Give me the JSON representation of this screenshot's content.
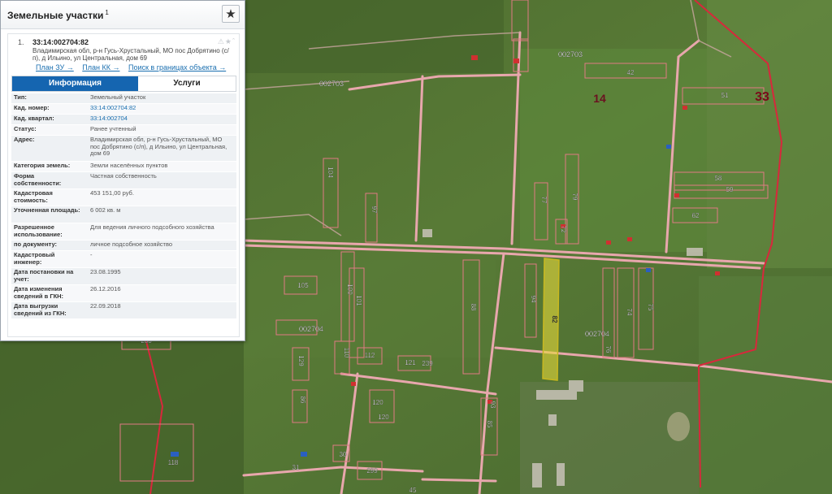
{
  "panel": {
    "title": "Земельные участки",
    "title_count": "1",
    "fav_icon": "★"
  },
  "result": {
    "number": "1.",
    "cad_number": "33:14:002704:82",
    "address": "Владимирская обл, р-н Гусь-Хрустальный, МО пос Добрятино (с/п), д Ильино, ул Центральная, дом 69",
    "links": [
      "План ЗУ →",
      "План КК →",
      "Поиск в границах объекта →"
    ],
    "tabs": {
      "info": "Информация",
      "services": "Услуги"
    },
    "rows": [
      {
        "label": "Тип:",
        "value": "Земельный участок"
      },
      {
        "label": "Кад. номер:",
        "value": "33:14:002704:82"
      },
      {
        "label": "Кад. квартал:",
        "value": "33:14:002704"
      },
      {
        "label": "Статус:",
        "value": "Ранее учтенный"
      },
      {
        "label": "Адрес:",
        "value": "Владимирская обл, р-н Гусь-Хрустальный, МО пос Добрятино (с/п), д Ильино, ул Центральная, дом 69"
      },
      {
        "label": "Категория земель:",
        "value": "Земли населённых пунктов"
      },
      {
        "label": "Форма собственности:",
        "value": "Частная собственность"
      },
      {
        "label": "Кадастровая стоимость:",
        "value": "453 151,00 руб."
      },
      {
        "label": "Уточненная площадь:",
        "value": "6 002 кв. м"
      },
      {
        "label": "Разрешенное использование:",
        "value": "Для ведения личного подсобного хозяйства"
      },
      {
        "label": "по документу:",
        "value": "личное подсобное хозяйство"
      },
      {
        "label": "Кадастровый инженер:",
        "value": "-"
      },
      {
        "label": "Дата постановки на учет:",
        "value": "23.08.1995"
      },
      {
        "label": "Дата изменения сведений в ГКН:",
        "value": "26.12.2016"
      },
      {
        "label": "Дата выгрузки сведений из ГКН:",
        "value": "22.09.2018"
      }
    ]
  },
  "map": {
    "colors": {
      "boundary": "#e8a0a8",
      "selected": "#e6d93a",
      "district_line": "#d8283c"
    },
    "labels": {
      "q1": "002703",
      "q2": "002703",
      "q3": "002704",
      "q4": "002704",
      "district14": "14",
      "district33": "33",
      "p42": "42",
      "p51": "51",
      "p58": "58",
      "p59": "59",
      "p62": "62",
      "p104": "104",
      "p97": "97",
      "p77": "77",
      "p79": "79",
      "p72": "72",
      "p105": "105",
      "p100": "100",
      "p101": "101",
      "p88": "88",
      "p94": "94",
      "p82": "82",
      "p74": "74",
      "p75": "75",
      "p76": "76",
      "p112": "112",
      "p121": "121",
      "p239": "239",
      "p120a": "120",
      "p120b": "120",
      "p118": "118",
      "p30": "30",
      "p31": "31",
      "p299": "299",
      "p129": "129",
      "p110": "110",
      "p86": "86",
      "p85": "85",
      "p93": "93",
      "p233": "233",
      "p45": "45"
    }
  }
}
